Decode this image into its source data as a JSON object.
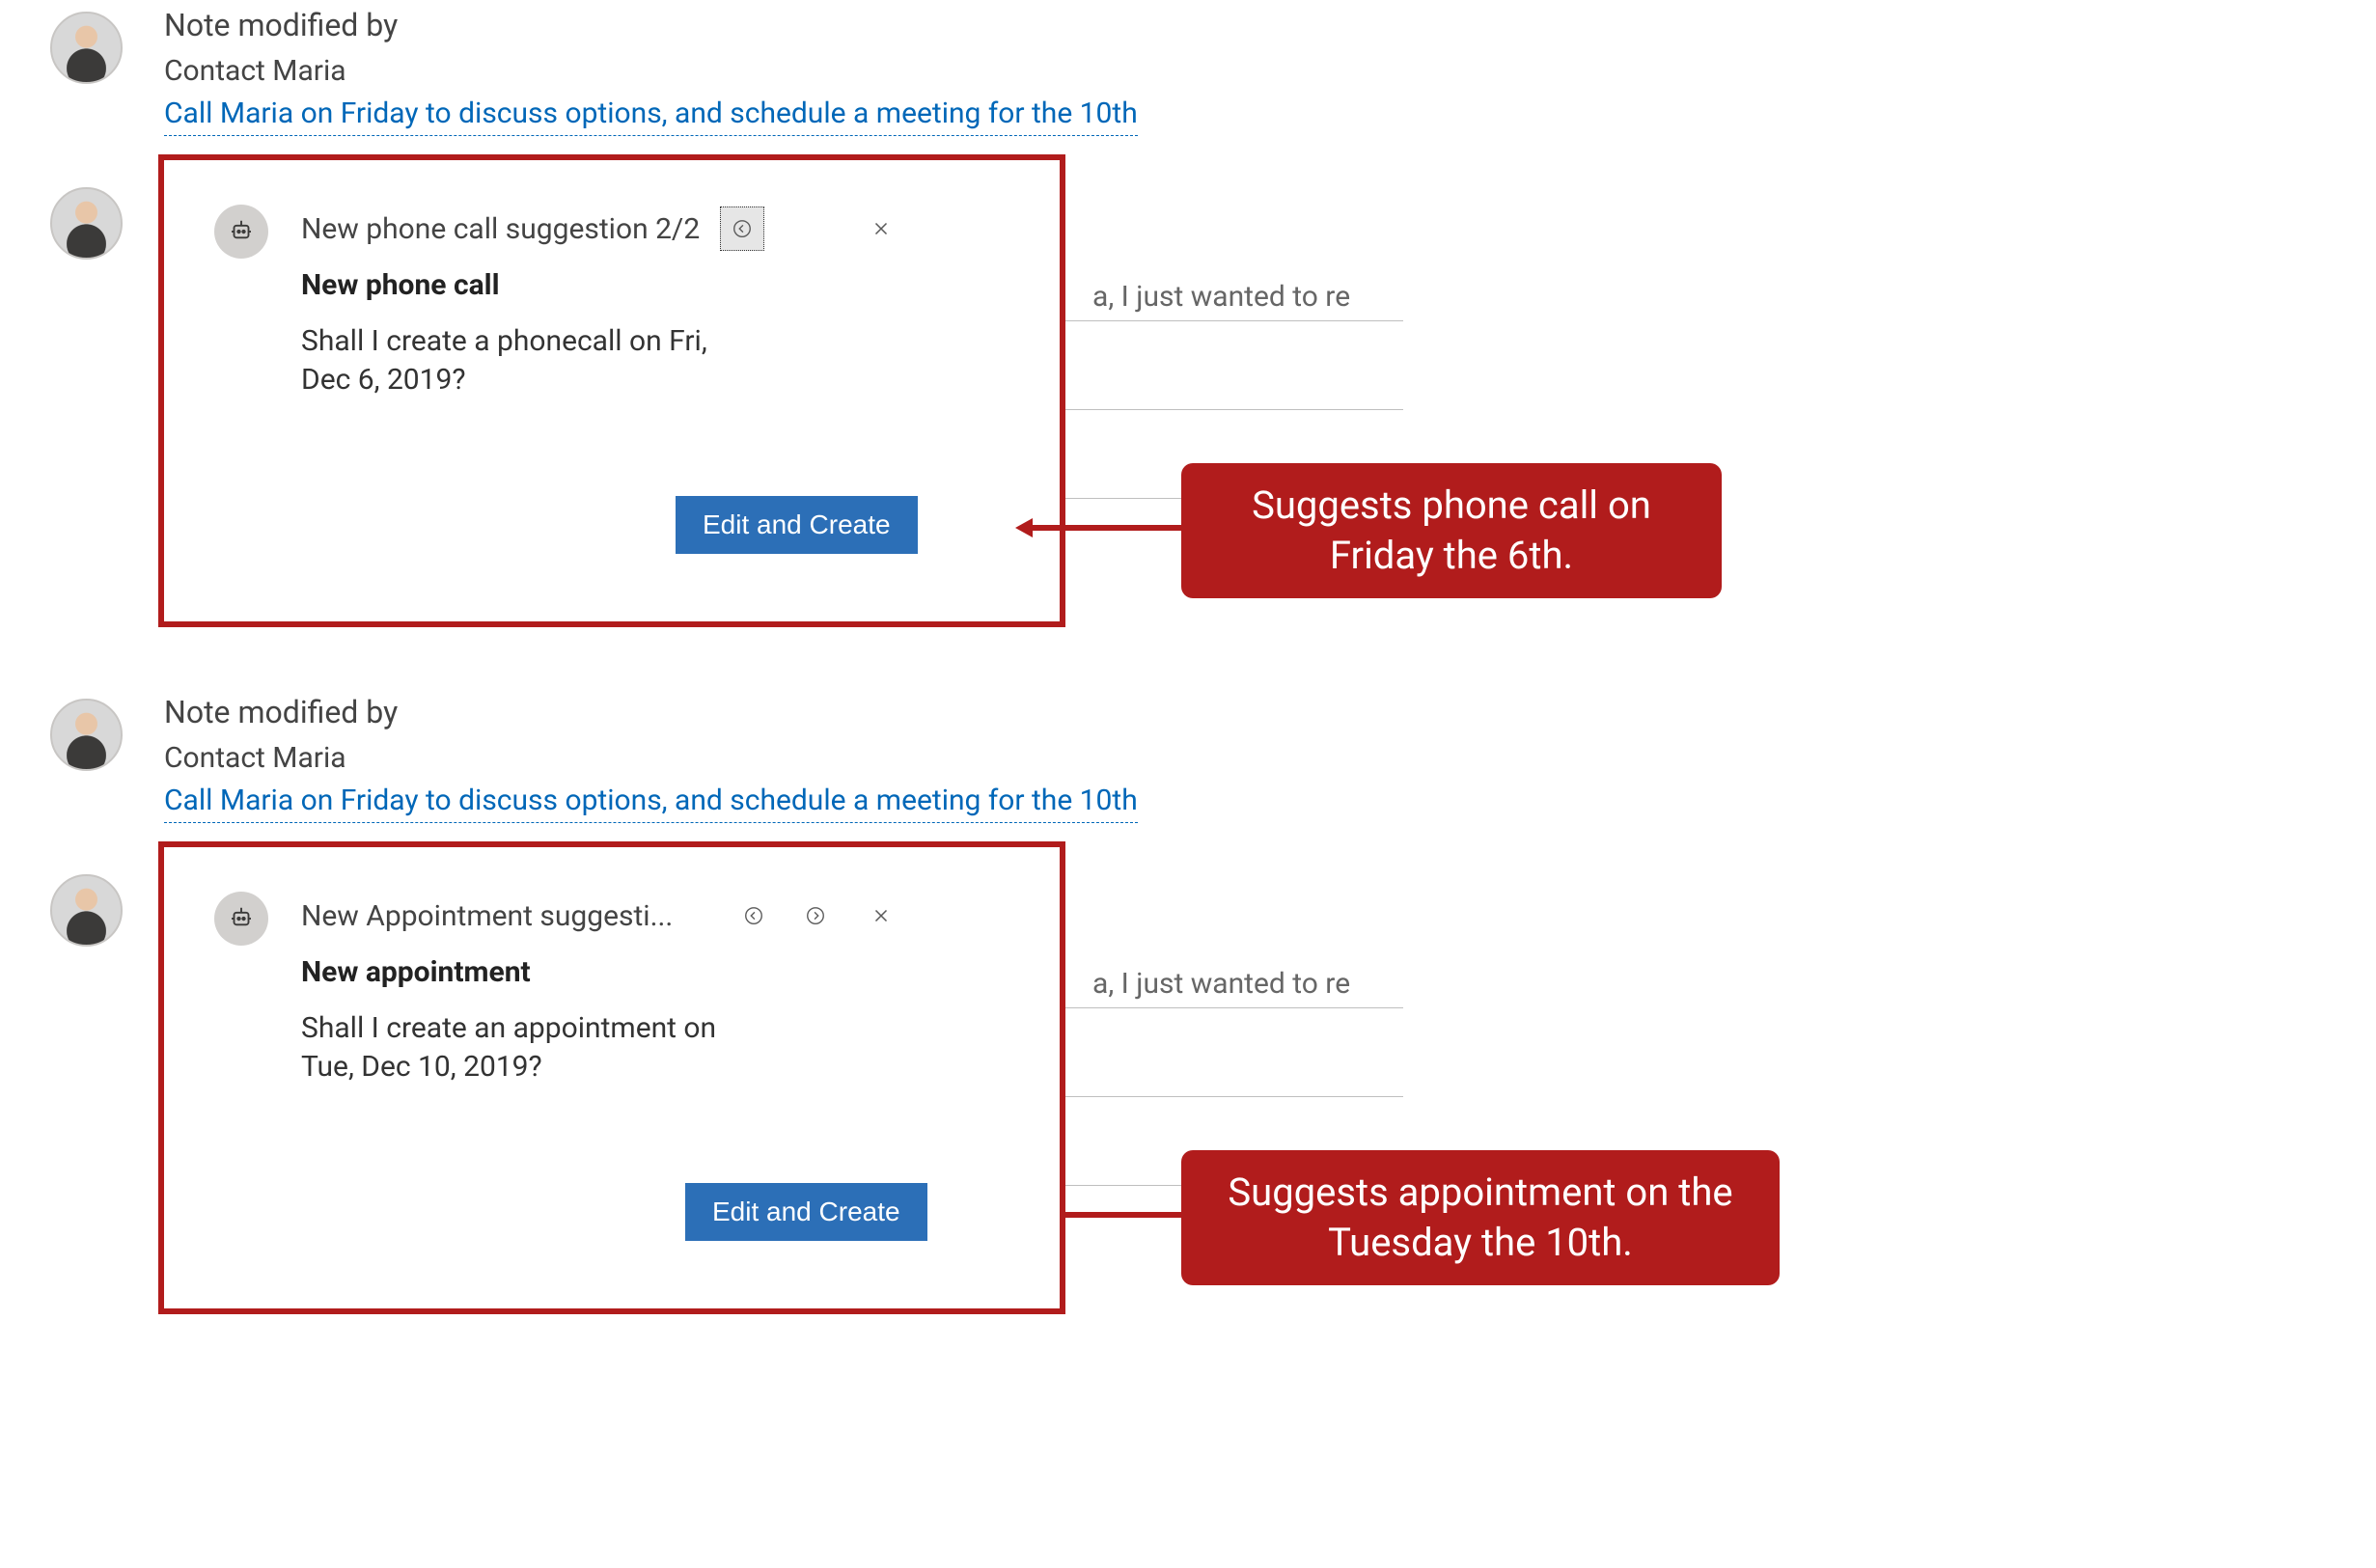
{
  "block1": {
    "note": {
      "modified_by": "Note modified by",
      "contact": "Contact Maria",
      "link": "Call Maria on Friday to discuss options, and schedule a meeting for the 10th"
    },
    "card": {
      "title": "New phone call suggestion 2/2",
      "bold": "New phone call",
      "body": "Shall I create a phonecall on Fri, Dec 6, 2019?",
      "button": "Edit and Create"
    },
    "ghost_fragment": "a, I just wanted to re",
    "callout": "Suggests phone call on Friday the 6th."
  },
  "block2": {
    "note": {
      "modified_by": "Note modified by",
      "contact": "Contact Maria",
      "link": "Call Maria on Friday to discuss options, and schedule a meeting for the 10th"
    },
    "card": {
      "title": "New Appointment suggesti...",
      "bold": "New appointment",
      "body": "Shall I create an appointment on Tue, Dec 10, 2019?",
      "button": "Edit and Create"
    },
    "ghost_fragment": "a, I just wanted to re",
    "callout": "Suggests appointment on the Tuesday the 10th."
  }
}
